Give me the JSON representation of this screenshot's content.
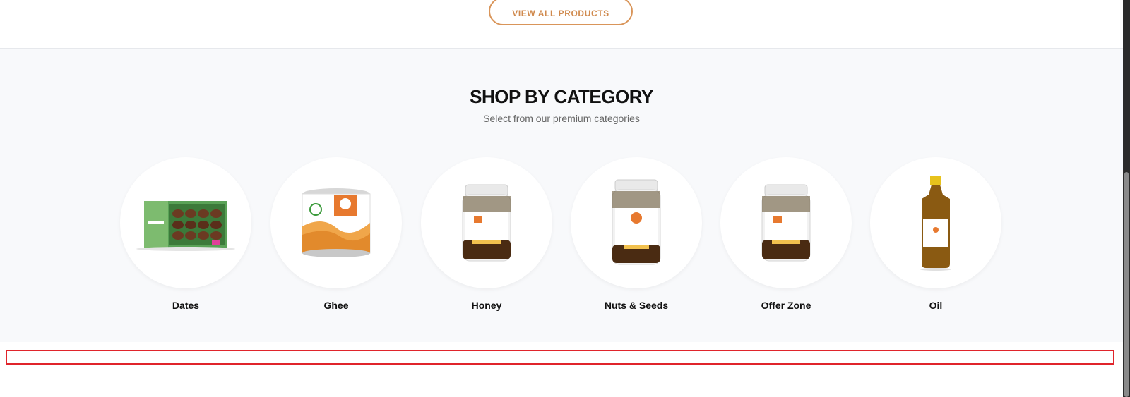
{
  "top": {
    "view_all_label": "VIEW ALL PRODUCTS"
  },
  "section": {
    "title": "SHOP BY CATEGORY",
    "subtitle": "Select from our premium categories"
  },
  "categories": [
    {
      "label": "Dates",
      "icon": "dates-box-image"
    },
    {
      "label": "Ghee",
      "icon": "ghee-tin-image"
    },
    {
      "label": "Honey",
      "icon": "honey-jar-image"
    },
    {
      "label": "Nuts & Seeds",
      "icon": "nuts-jar-image"
    },
    {
      "label": "Offer Zone",
      "icon": "offer-jar-image"
    },
    {
      "label": "Oil",
      "icon": "oil-bottle-image"
    }
  ],
  "colors": {
    "accent": "#d9955a",
    "section_bg": "#f8f9fb",
    "highlight_border": "#e0242b"
  }
}
